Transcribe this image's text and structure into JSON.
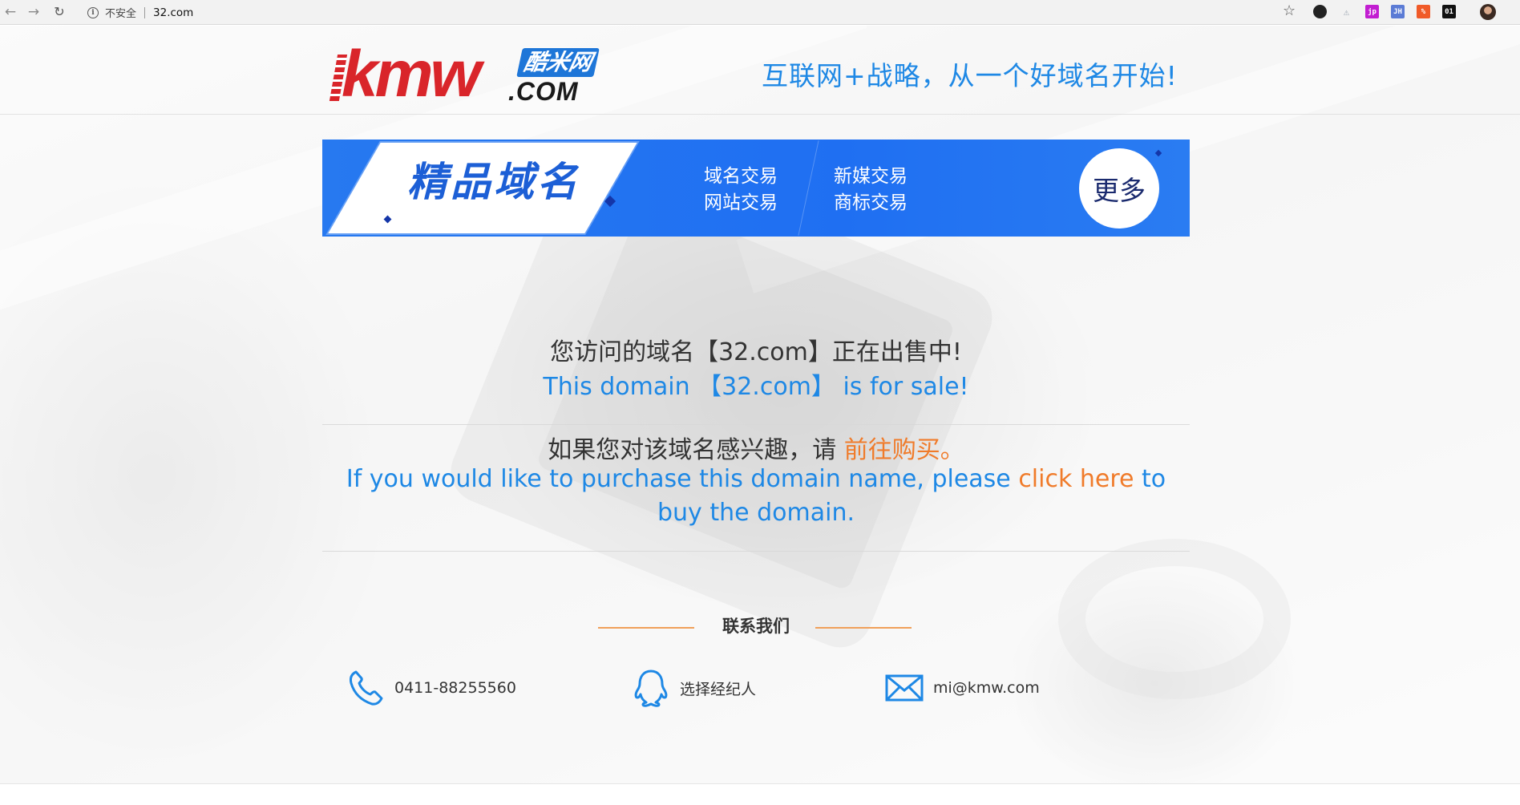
{
  "browser": {
    "back_glyph": "←",
    "forward_glyph": "→",
    "reload_glyph": "↻",
    "security_label": "不安全",
    "url": "32.com",
    "bookmark_glyph": "☆",
    "extensions": [
      {
        "name": "github-icon",
        "label": "",
        "color": "#222222"
      },
      {
        "name": "extension-icon",
        "label": "",
        "color": "#9aa3b0"
      },
      {
        "name": "jp-icon",
        "label": "jp",
        "color": "#c21ed1"
      },
      {
        "name": "jh-icon",
        "label": "JH",
        "color": "#5b7bd5"
      },
      {
        "name": "percent-icon",
        "label": "%",
        "color": "#f05a28"
      },
      {
        "name": "zero-one-icon",
        "label": "01",
        "color": "#111111"
      }
    ]
  },
  "header": {
    "logo_text": "kmw",
    "logo_cn": "酷米网",
    "logo_com": ".COM",
    "slogan": "互联网+战略，从一个好域名开始!"
  },
  "banner": {
    "title": "精品域名",
    "links": [
      "域名交易",
      "网站交易",
      "新媒交易",
      "商标交易"
    ],
    "more": "更多",
    "colors": {
      "background": "#1f6ff2",
      "title": "#1c5fd6"
    }
  },
  "main": {
    "cn_line1": "您访问的域名【32.com】正在出售中!",
    "en_line1": "This domain 【32.com】 is for sale!",
    "cn_line2_prefix": "如果您对该域名感兴趣，请",
    "cn_line2_link": "前往购买。",
    "en_line2_prefix": "If you would like to purchase this domain name, please",
    "en_line2_link": "click here",
    "en_line2_suffix": "to buy the domain.",
    "colors": {
      "accent": "#1e88e5",
      "link": "#f07b2a",
      "text": "#333333"
    }
  },
  "contact": {
    "title": "联系我们",
    "phone": "0411-88255560",
    "agent": "选择经纪人",
    "email": "mi@kmw.com",
    "icons": [
      "phone-icon",
      "qq-icon",
      "mail-icon"
    ]
  }
}
